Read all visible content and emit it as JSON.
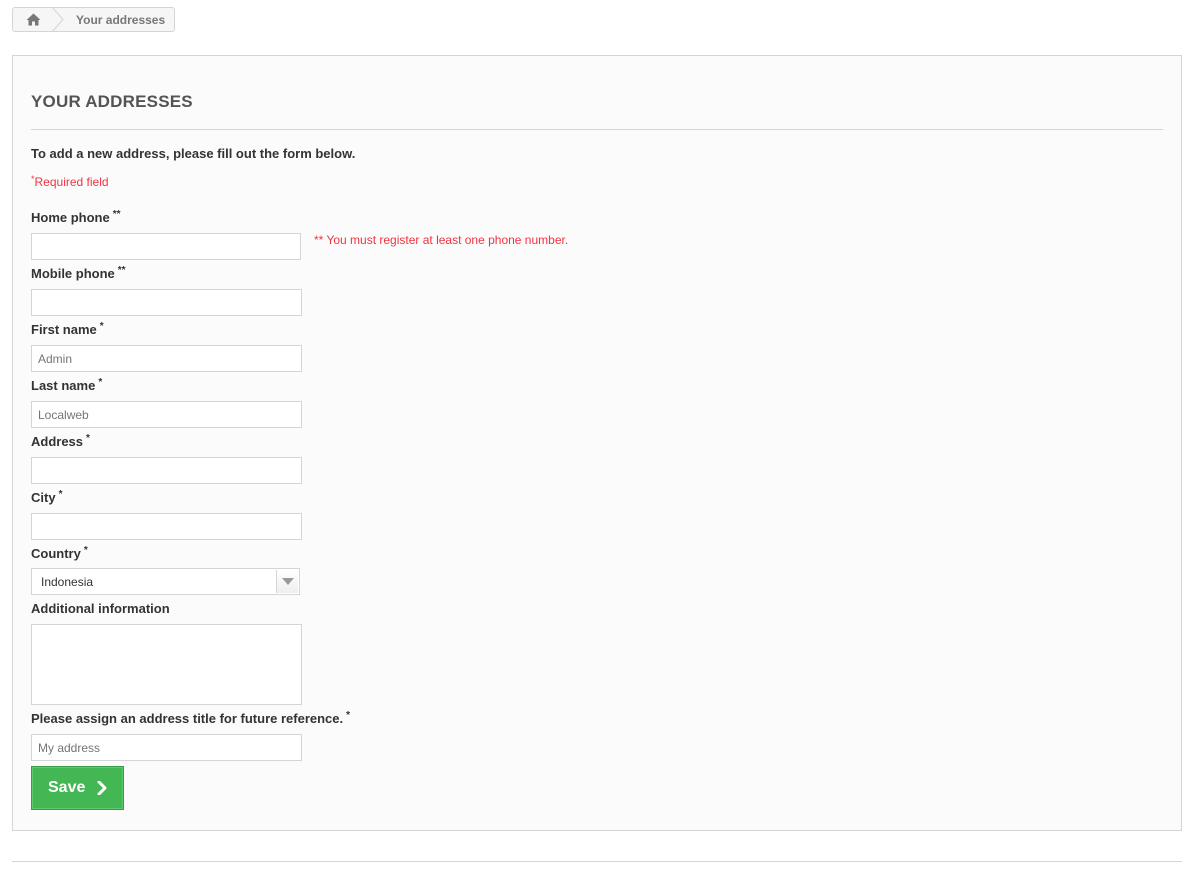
{
  "breadcrumb": {
    "home_icon": "home-icon",
    "current": "Your addresses"
  },
  "page": {
    "heading": "YOUR ADDRESSES",
    "intro": "To add a new address, please fill out the form below.",
    "required_mark": "*",
    "required_note": "Required field"
  },
  "form": {
    "home_phone": {
      "label": "Home phone",
      "mark": "**",
      "value": ""
    },
    "phone_hint": "** You must register at least one phone number.",
    "mobile_phone": {
      "label": "Mobile phone",
      "mark": "**",
      "value": ""
    },
    "first_name": {
      "label": "First name",
      "mark": "*",
      "placeholder": "Admin"
    },
    "last_name": {
      "label": "Last name",
      "mark": "*",
      "placeholder": "Localweb"
    },
    "address": {
      "label": "Address",
      "mark": "*",
      "value": ""
    },
    "city": {
      "label": "City",
      "mark": "*",
      "value": ""
    },
    "country": {
      "label": "Country",
      "mark": "*",
      "selected": "Indonesia"
    },
    "additional": {
      "label": "Additional information",
      "value": ""
    },
    "alias": {
      "label": "Please assign an address title for future reference.",
      "mark": "*",
      "placeholder": "My address"
    },
    "save_label": "Save"
  },
  "colors": {
    "accent_green": "#43b754",
    "required_red": "#f13340"
  }
}
